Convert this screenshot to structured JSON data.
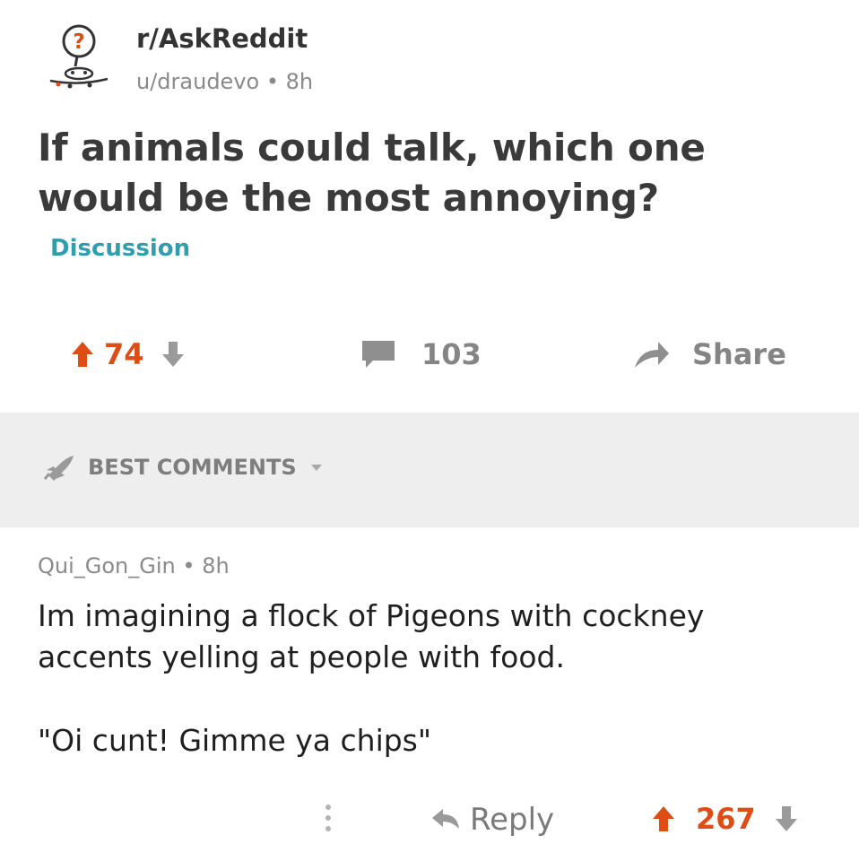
{
  "post": {
    "subreddit": "r/AskReddit",
    "author": "u/draudevo",
    "separator": "•",
    "age": "8h",
    "title": "If animals could talk, which one would be the most annoying?",
    "flair": "Discussion",
    "upvotes": "74",
    "comments": "103",
    "share_label": "Share"
  },
  "sort": {
    "label": "BEST COMMENTS"
  },
  "comment": {
    "author": "Qui_Gon_Gin",
    "separator": "•",
    "age": "8h",
    "body": "Im imagining a flock of Pigeons with cockney accents yelling at people with food.",
    "quote": "\"Oi cunt! Gimme ya chips\"",
    "reply_label": "Reply",
    "upvotes": "267"
  },
  "colors": {
    "upvote": "#de4d14",
    "muted": "#858585",
    "flair": "#2f9fb0",
    "sort_bar": "#eeeeee"
  },
  "icons": {
    "avatar": "askreddit-avatar-icon",
    "upvote": "upvote-arrow-icon",
    "downvote": "downvote-arrow-icon",
    "comment": "comment-bubble-icon",
    "share": "share-arrow-icon",
    "sort": "rocket-icon",
    "dropdown": "chevron-down-icon",
    "more": "more-vertical-icon",
    "reply": "reply-arrow-icon"
  }
}
